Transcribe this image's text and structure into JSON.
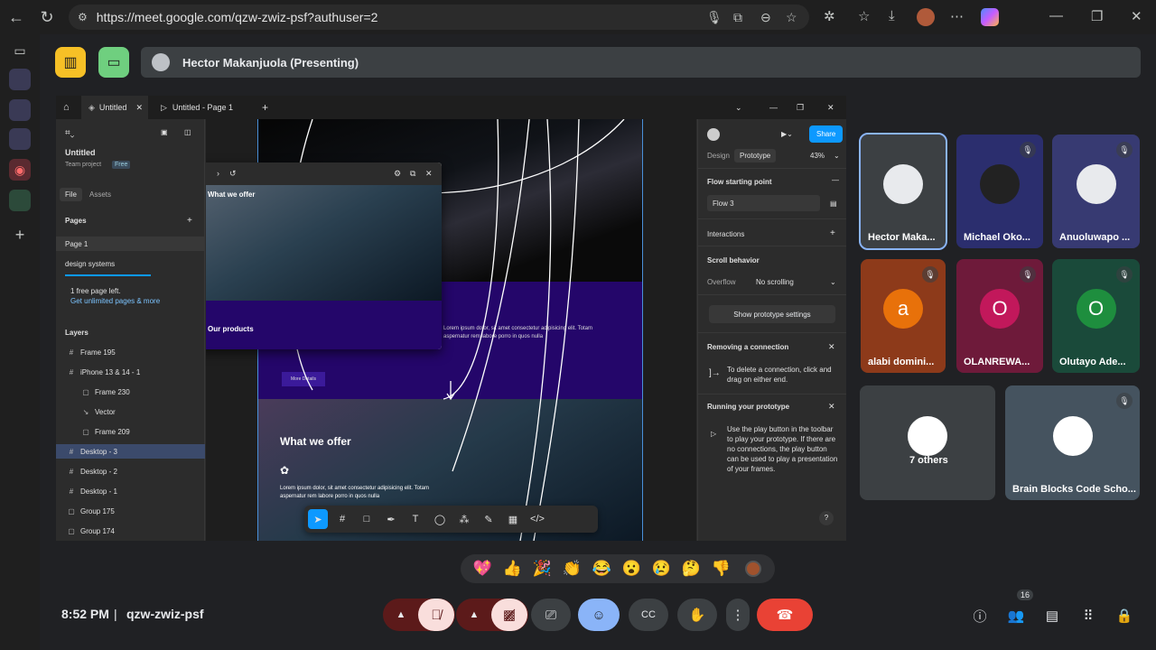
{
  "browser": {
    "url": "https://meet.google.com/qzw-zwiz-psf?authuser=2"
  },
  "meet": {
    "presenter_label": "Hector Makanjuola (Presenting)",
    "time": "8:52 PM",
    "separator": "|",
    "meeting_code": "qzw-zwiz-psf",
    "people_count": "16"
  },
  "figma": {
    "tabs": [
      "Untitled",
      "Untitled - Page 1"
    ],
    "file_name": "Untitled",
    "team": "Team project",
    "plan": "Free",
    "sidebar_tabs": [
      "File",
      "Assets"
    ],
    "pages_title": "Pages",
    "pages": [
      "Page 1",
      "design systems"
    ],
    "upsell_line1": "1 free page left.",
    "upsell_line2": "Get unlimited pages & more",
    "layers_title": "Layers",
    "layers": [
      {
        "name": "Frame 195",
        "glyph": "#"
      },
      {
        "name": "iPhone 13 & 14 - 1",
        "glyph": "#"
      },
      {
        "name": "Frame 230",
        "glyph": "▢"
      },
      {
        "name": "Vector",
        "glyph": "↘"
      },
      {
        "name": "Frame 209",
        "glyph": "▢"
      },
      {
        "name": "Desktop - 3",
        "glyph": "#"
      },
      {
        "name": "Desktop - 2",
        "glyph": "#"
      },
      {
        "name": "Desktop - 1",
        "glyph": "#"
      },
      {
        "name": "Group 175",
        "glyph": "▢"
      },
      {
        "name": "Group 174",
        "glyph": "▢"
      }
    ],
    "share_label": "Share",
    "right_tabs": [
      "Design",
      "Prototype"
    ],
    "zoom": "43%",
    "flow_title": "Flow starting point",
    "flow_name": "Flow 3",
    "interactions": "Interactions",
    "scroll_behavior": "Scroll behavior",
    "overflow_label": "Overflow",
    "overflow_value": "No scrolling",
    "show_settings": "Show prototype settings",
    "removing_title": "Removing a connection",
    "removing_body": "To delete a connection, click and drag on either end.",
    "running_title": "Running your prototype",
    "running_body": "Use the play button in the toolbar to play your prototype. If there are no connections, the play button can be used to play a presentation of your frames.",
    "help": "?",
    "canvas_heading_1": "What we offer",
    "canvas_heading_2": "Our products",
    "canvas_button": "More Details",
    "canvas_heading_3": "What we offer",
    "canvas_lorem": "Lorem ipsum dolor, sit amet consectetur adipisicing elit. Totam aspernatur rem labore porro in quos nulla"
  },
  "participants": [
    {
      "name": "Hector Maka...",
      "initial": "",
      "color": "#3c4043",
      "muted": false,
      "active": true
    },
    {
      "name": "Michael Oko...",
      "initial": "",
      "color": "#2b2e6e",
      "muted": true,
      "active": false
    },
    {
      "name": "Anuoluwapo ...",
      "initial": "",
      "color": "#373a72",
      "muted": true,
      "active": false
    },
    {
      "name": "alabi domini...",
      "initial": "a",
      "color": "#8d3a1a",
      "muted": true,
      "active": false
    },
    {
      "name": "OLANREWA...",
      "initial": "O",
      "color": "#6e1a3a",
      "muted": true,
      "active": false
    },
    {
      "name": "Olutayo Ade...",
      "initial": "O",
      "color": "#1a4a3a",
      "muted": true,
      "active": false
    },
    {
      "name": "7 others",
      "initial": "",
      "color": "#3c4043",
      "muted": false,
      "active": false
    },
    {
      "name": "Brain Blocks Code Scho...",
      "initial": "",
      "color": "#45535f",
      "muted": true,
      "active": false
    }
  ],
  "reactions": [
    "💖",
    "👍",
    "🎉",
    "👏",
    "😂",
    "😮",
    "😢",
    "🤔",
    "👎"
  ],
  "colors": {
    "end_call": "#e94235",
    "muted_red": "#5c1a1a",
    "muted_pink": "#f9dedc",
    "accent_blue": "#8ab4f8",
    "figma_blue": "#0d99ff"
  }
}
